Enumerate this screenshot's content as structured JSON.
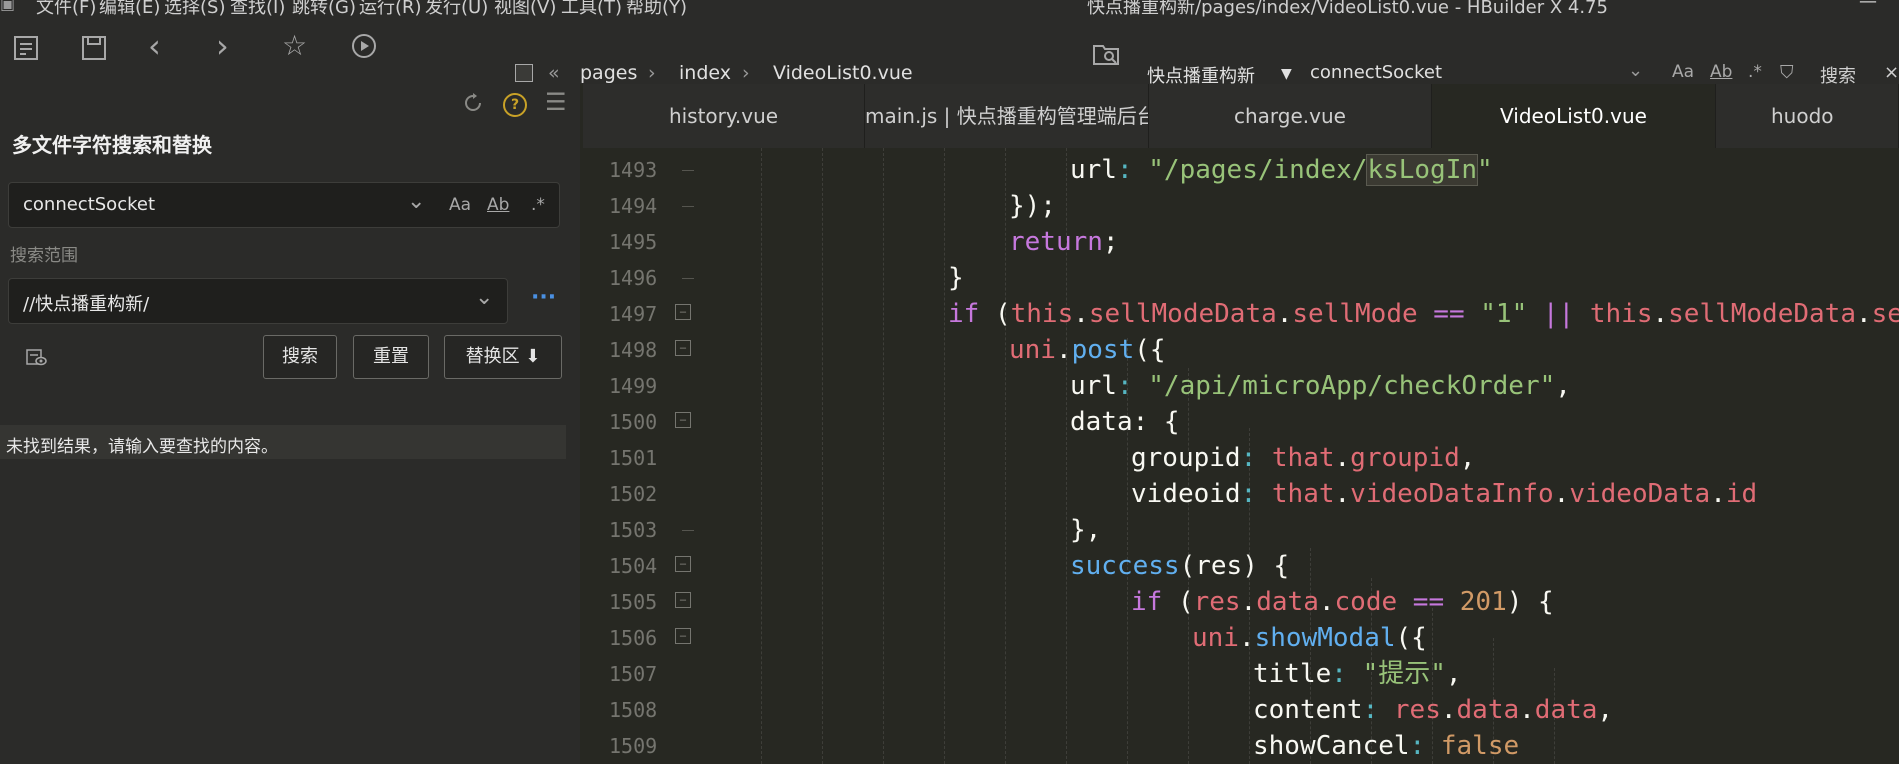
{
  "menubar": {
    "items": [
      "文件(F)",
      "编辑(E)",
      "选择(S)",
      "查找(I)",
      "跳转(G)",
      "运行(R)",
      "发行(U)",
      "视图(V)",
      "工具(T)",
      "帮助(Y)"
    ],
    "window_title": "快点播重构新/pages/index/VideoList0.vue - HBuilder X 4.75"
  },
  "toolbar": {
    "breadcrumb": [
      "pages",
      "index",
      "VideoList0.vue"
    ],
    "project": "快点播重构新",
    "search_value": "connectSocket",
    "case_label": "Aa",
    "word_label": "Ab",
    "regex_label": ".*",
    "search_label": "搜索"
  },
  "search_panel": {
    "title": "多文件字符搜索和替换",
    "query": "connectSocket",
    "case_label": "Aa",
    "word_label": "Ab",
    "regex_label": ".*",
    "scope_label": "搜索范围",
    "scope_value": "//快点播重构新/",
    "more_label": "···",
    "search_button": "搜索",
    "reset_button": "重置",
    "replace_button": "替换区 ⬇",
    "help_label": "?",
    "no_result": "未找到结果，请输入要查找的内容。"
  },
  "tabs": [
    {
      "label": "history.vue",
      "active": false
    },
    {
      "label": "main.js | 快点播重构管理端后台",
      "active": false
    },
    {
      "label": "charge.vue",
      "active": false
    },
    {
      "label": "VideoList0.vue",
      "active": true
    },
    {
      "label": "huodo",
      "active": false
    }
  ],
  "editor": {
    "lines": [
      {
        "num": "1493",
        "fold": "line"
      },
      {
        "num": "1494",
        "fold": "line"
      },
      {
        "num": "1495",
        "fold": "none"
      },
      {
        "num": "1496",
        "fold": "line"
      },
      {
        "num": "1497",
        "fold": "box"
      },
      {
        "num": "1498",
        "fold": "box"
      },
      {
        "num": "1499",
        "fold": "none"
      },
      {
        "num": "1500",
        "fold": "box"
      },
      {
        "num": "1501",
        "fold": "none"
      },
      {
        "num": "1502",
        "fold": "none"
      },
      {
        "num": "1503",
        "fold": "line"
      },
      {
        "num": "1504",
        "fold": "box"
      },
      {
        "num": "1505",
        "fold": "box"
      },
      {
        "num": "1506",
        "fold": "box"
      },
      {
        "num": "1507",
        "fold": "none"
      },
      {
        "num": "1508",
        "fold": "none"
      },
      {
        "num": "1509",
        "fold": "none"
      }
    ],
    "code": {
      "l1493": {
        "t1": "url",
        "t2": ": ",
        "t3": "\"/pages/index/",
        "t4": "ksLogIn",
        "t5": "\""
      },
      "l1494": {
        "t1": "});"
      },
      "l1495": {
        "t1": "return",
        "t2": ";"
      },
      "l1496": {
        "t1": "}"
      },
      "l1497": {
        "t1": "if",
        "t2": " (",
        "t3": "this",
        "t4": ".",
        "t5": "sellModeData",
        "t6": ".",
        "t7": "sellMode",
        "t8": " == ",
        "t9": "\"1\"",
        "t10": " || ",
        "t11": "this",
        "t12": ".",
        "t13": "sellModeData",
        "t14": ".",
        "t15": "sel"
      },
      "l1498": {
        "t1": "uni",
        "t2": ".",
        "t3": "post",
        "t4": "({"
      },
      "l1499": {
        "t1": "url",
        "t2": ": ",
        "t3": "\"/api/microApp/checkOrder\"",
        "t4": ","
      },
      "l1500": {
        "t1": "data",
        "t2": ": {"
      },
      "l1501": {
        "t1": "groupid",
        "t2": ": ",
        "t3": "that",
        "t4": ".",
        "t5": "groupid",
        "t6": ","
      },
      "l1502": {
        "t1": "videoid",
        "t2": ": ",
        "t3": "that",
        "t4": ".",
        "t5": "videoDataInfo",
        "t6": ".",
        "t7": "videoData",
        "t8": ".",
        "t9": "id"
      },
      "l1503": {
        "t1": "},"
      },
      "l1504": {
        "t1": "success",
        "t2": "(res) {"
      },
      "l1505": {
        "t1": "if",
        "t2": " (",
        "t3": "res",
        "t4": ".",
        "t5": "data",
        "t6": ".",
        "t7": "code",
        "t8": " == ",
        "t9": "201",
        "t10": ") {"
      },
      "l1506": {
        "t1": "uni",
        "t2": ".",
        "t3": "showModal",
        "t4": "({"
      },
      "l1507": {
        "t1": "title",
        "t2": ": ",
        "t3": "\"提示\"",
        "t4": ","
      },
      "l1508": {
        "t1": "content",
        "t2": ": ",
        "t3": "res",
        "t4": ".",
        "t5": "data",
        "t6": ".",
        "t7": "data",
        "t8": ","
      },
      "l1509": {
        "t1": "showCancel",
        "t2": ": ",
        "t3": "false"
      }
    }
  },
  "colors": {
    "editor_bg": "#272822",
    "panel_bg": "#2b2b29",
    "keyword": "#c678dd",
    "property": "#e06c75",
    "string": "#98c379",
    "function": "#61afef",
    "number": "#d19a66"
  }
}
